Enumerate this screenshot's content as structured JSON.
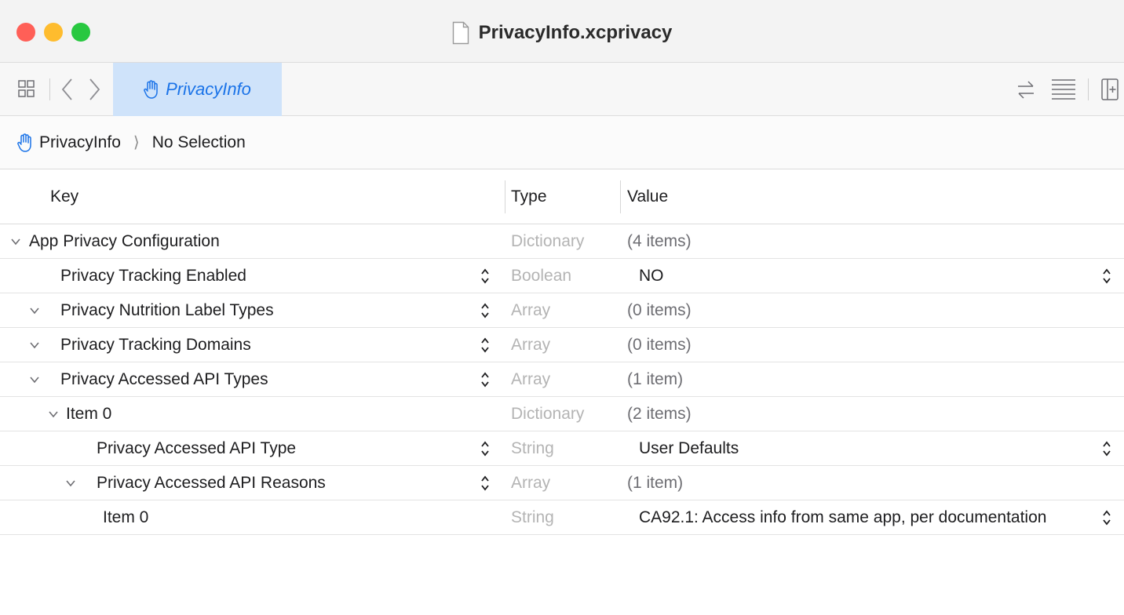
{
  "window": {
    "title": "PrivacyInfo.xcprivacy"
  },
  "tabbar": {
    "active_tab_label": "PrivacyInfo"
  },
  "breadcrumb": {
    "root": "PrivacyInfo",
    "current": "No Selection"
  },
  "table": {
    "headers": {
      "key": "Key",
      "type": "Type",
      "value": "Value"
    },
    "rows": [
      {
        "key": "App Privacy Configuration",
        "type": "Dictionary",
        "value": "(4 items)"
      },
      {
        "key": "Privacy Tracking Enabled",
        "type": "Boolean",
        "value": "NO"
      },
      {
        "key": "Privacy Nutrition Label Types",
        "type": "Array",
        "value": "(0 items)"
      },
      {
        "key": "Privacy Tracking Domains",
        "type": "Array",
        "value": "(0 items)"
      },
      {
        "key": "Privacy Accessed API Types",
        "type": "Array",
        "value": "(1 item)"
      },
      {
        "key": "Item 0",
        "type": "Dictionary",
        "value": "(2 items)"
      },
      {
        "key": "Privacy Accessed API Type",
        "type": "String",
        "value": "User Defaults"
      },
      {
        "key": "Privacy Accessed API Reasons",
        "type": "Array",
        "value": "(1 item)"
      },
      {
        "key": "Item 0",
        "type": "String",
        "value": "CA92.1: Access info from same app, per documentation"
      }
    ]
  },
  "colors": {
    "accent": "#1a73e8",
    "active_tab_bg": "#cfe3fa",
    "traffic_red": "#ff5f57",
    "traffic_yellow": "#febc2e",
    "traffic_green": "#28c840"
  }
}
